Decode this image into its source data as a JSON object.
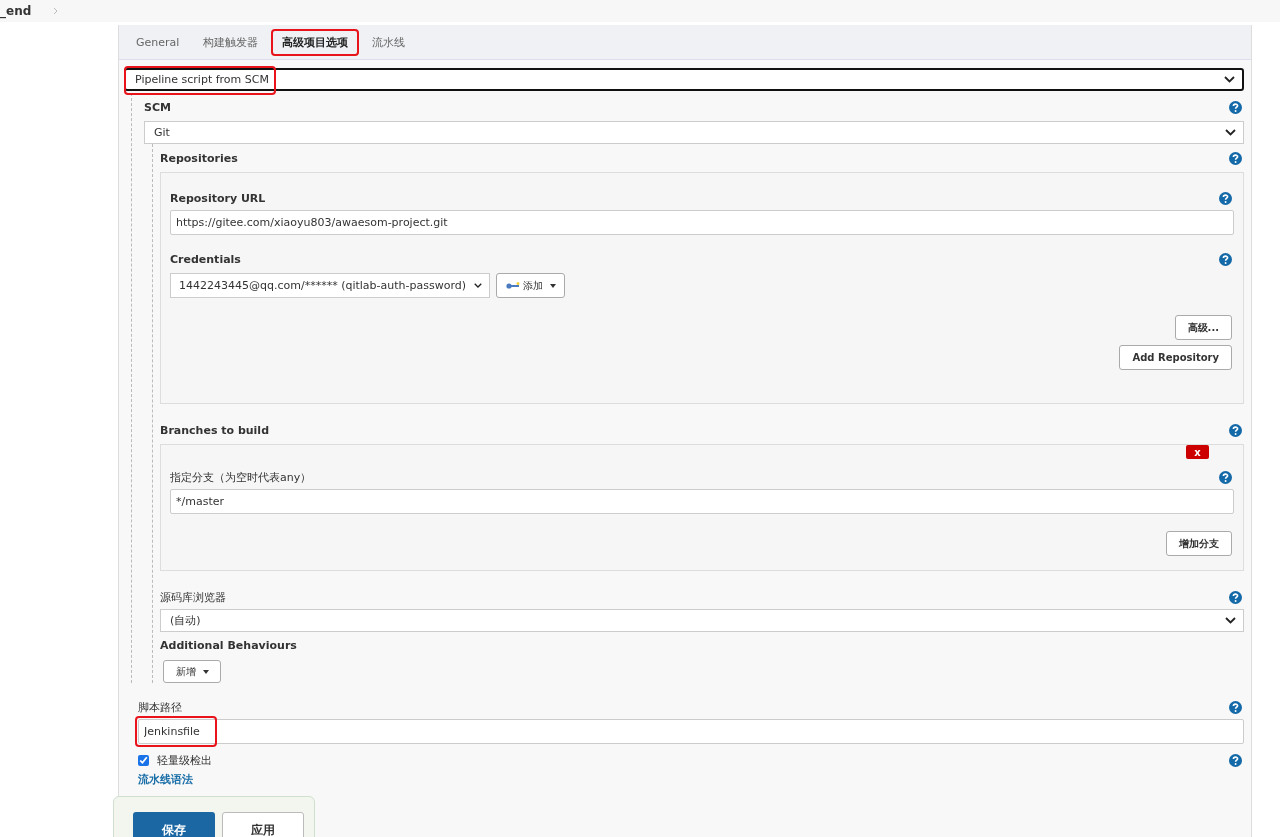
{
  "breadcrumb": {
    "label": "_end"
  },
  "tabs": [
    {
      "label": "General",
      "selected": false,
      "highlighted": false
    },
    {
      "label": "构建触发器",
      "selected": false,
      "highlighted": false
    },
    {
      "label": "高级项目选项",
      "selected": true,
      "highlighted": true
    },
    {
      "label": "流水线",
      "selected": false,
      "highlighted": false
    }
  ],
  "definition": {
    "value": "Pipeline script from SCM",
    "highlighted": true
  },
  "scm": {
    "label": "SCM",
    "value": "Git",
    "repositories": {
      "label": "Repositories",
      "url_label": "Repository URL",
      "url": "https://gitee.com/xiaoyu803/awaesom-project.git",
      "credentials_label": "Credentials",
      "credentials": "1442243445@qq.com/****** (qitlab-auth-password)",
      "add_button": "添加",
      "advanced_button": "高级...",
      "add_repository_button": "Add Repository"
    },
    "branches": {
      "label": "Branches to build",
      "delete_button": "x",
      "branch_label": "指定分支（为空时代表any）",
      "branch": "*/master",
      "add_branch_button": "增加分支"
    },
    "browser": {
      "label": "源码库浏览器",
      "value": "(自动)"
    },
    "additional_behaviours": {
      "label": "Additional Behaviours",
      "add_button": "新增"
    }
  },
  "script_path": {
    "label": "脚本路径",
    "value": "Jenkinsfile",
    "highlighted": true
  },
  "lightweight_checkout": {
    "label": "轻量级检出",
    "checked": true
  },
  "pipeline_syntax_link": "流水线语法",
  "buttons": [
    {
      "label": "保存",
      "kind": "primary"
    },
    {
      "label": "应用",
      "kind": "secondary"
    }
  ]
}
